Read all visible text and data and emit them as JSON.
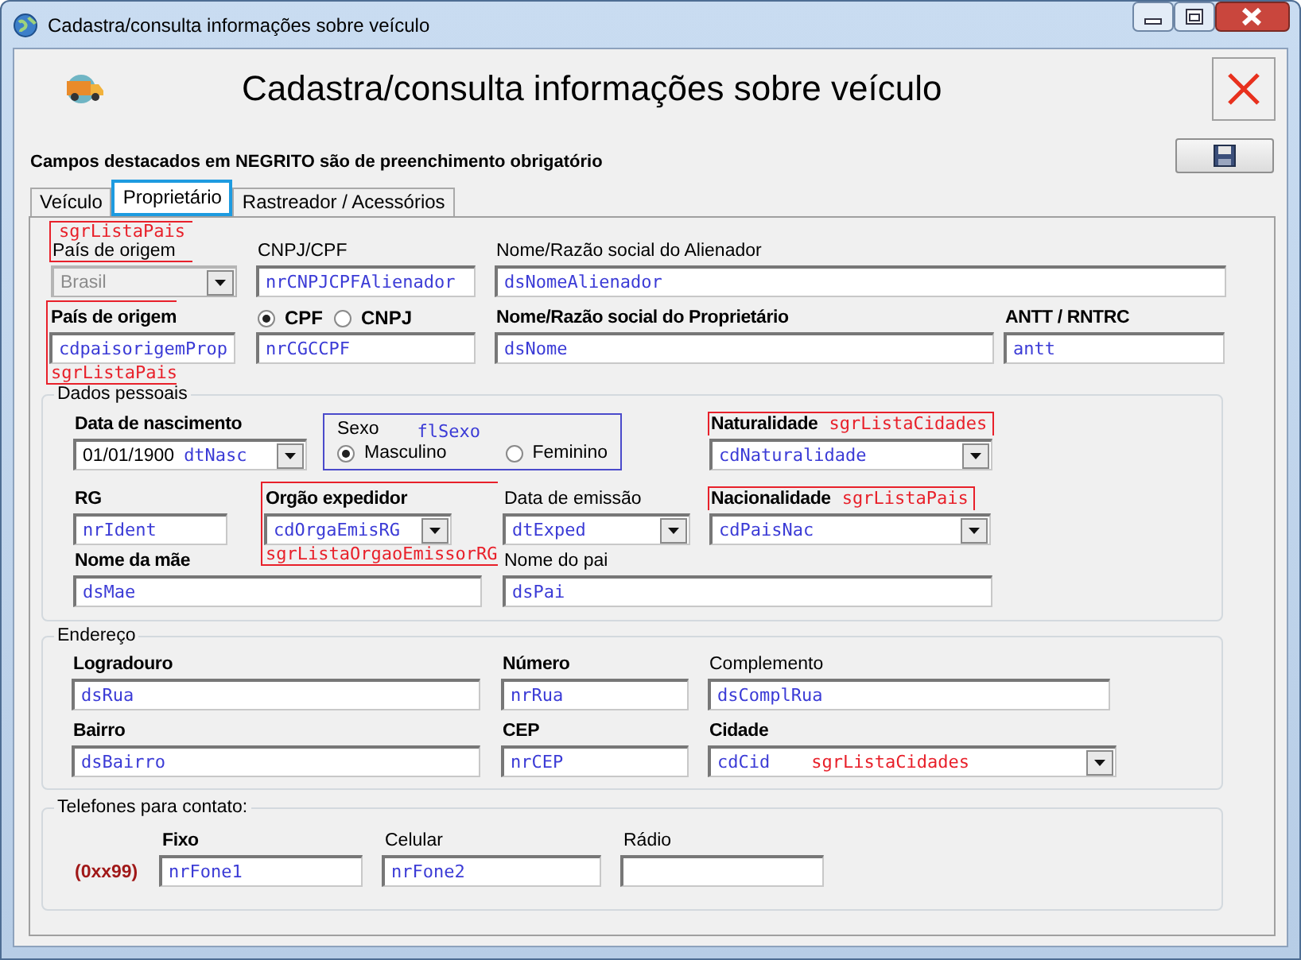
{
  "window": {
    "title": "Cadastra/consulta informações sobre veículo"
  },
  "header": {
    "title": "Cadastra/consulta informações sobre veículo"
  },
  "note": "Campos destacados em NEGRITO são de preenchimento obrigatório",
  "tabs": [
    {
      "label": "Veículo",
      "selected": false
    },
    {
      "label": "Proprietário",
      "selected": true
    },
    {
      "label": "Rastreador / Acessórios",
      "selected": false
    }
  ],
  "lines": [
    [
      {
        "kind": "combo",
        "label": "País de origem",
        "required": false,
        "value": "Brasil",
        "disabled": true,
        "annotation": {
          "text": "sgrListaPais",
          "kind": "above"
        }
      },
      {
        "kind": "text",
        "label": "CNPJ/CPF",
        "required": false,
        "binding": "nrCNPJCPFAlienador",
        "disabled": false
      },
      {
        "kind": "text",
        "label": "Nome/Razão social do Alienador",
        "required": false,
        "binding": "dsNomeAlienador",
        "disabled": false
      }
    ],
    [
      {
        "kind": "text",
        "label": "País de origem",
        "required": true,
        "binding": "cdpaisorigemProp",
        "disabled": false,
        "annotation": {
          "text": "sgrListaPais",
          "kind": "below"
        }
      },
      {
        "kind": "choice-text",
        "options": [
          {
            "label": "CPF",
            "selected": true
          },
          {
            "label": "CNPJ",
            "selected": false
          }
        ],
        "required": true,
        "binding": "nrCGCCPF",
        "disabled": false
      },
      {
        "kind": "text",
        "label": "Nome/Razão social do Proprietário",
        "required": true,
        "binding": "dsNome",
        "disabled": false
      },
      {
        "kind": "text",
        "label": "ANTT / RNTRC",
        "required": true,
        "binding": "antt",
        "disabled": false
      }
    ]
  ],
  "groups": [
    {
      "title": "Dados pessoais",
      "lines": [
        [
          {
            "kind": "combo",
            "label": "Data de nascimento",
            "required": true,
            "value": "01/01/1900",
            "binding": "dtNasc",
            "disabled": false
          },
          {
            "kind": "radio-group",
            "label": "Sexo",
            "binding": "flSexo",
            "options": [
              {
                "label": "Masculino",
                "selected": true
              },
              {
                "label": "Feminino",
                "selected": false
              }
            ]
          },
          {
            "kind": "combo",
            "label": "Naturalidade",
            "required": true,
            "binding": "cdNaturalidade",
            "disabled": false,
            "annotation": {
              "text": "sgrListaCidades",
              "kind": "beside"
            }
          }
        ],
        [
          {
            "kind": "text",
            "label": "RG",
            "required": true,
            "binding": "nrIdent",
            "disabled": false
          },
          {
            "kind": "combo",
            "label": "Orgão expedidor",
            "required": true,
            "binding": "cdOrgaEmisRG",
            "disabled": false,
            "annotation": {
              "text": "sgrListaOrgaoEmissorRG",
              "kind": "below"
            }
          },
          {
            "kind": "combo",
            "label": "Data de emissão",
            "required": false,
            "binding": "dtExped",
            "disabled": false
          },
          {
            "kind": "combo",
            "label": "Nacionalidade",
            "required": true,
            "binding": "cdPaisNac",
            "disabled": false,
            "annotation": {
              "text": "sgrListaPais",
              "kind": "beside"
            }
          }
        ],
        [
          {
            "kind": "text",
            "label": "Nome da mãe",
            "required": true,
            "binding": "dsMae",
            "disabled": false
          },
          {
            "kind": "text",
            "label": "Nome do pai",
            "required": false,
            "binding": "dsPai",
            "disabled": false
          }
        ]
      ]
    },
    {
      "title": "Endereço",
      "lines": [
        [
          {
            "kind": "text",
            "label": "Logradouro",
            "required": true,
            "binding": "dsRua",
            "disabled": false
          },
          {
            "kind": "text",
            "label": "Número",
            "required": true,
            "binding": "nrRua",
            "disabled": false
          },
          {
            "kind": "text",
            "label": "Complemento",
            "required": false,
            "binding": "dsComplRua",
            "disabled": false
          }
        ],
        [
          {
            "kind": "text",
            "label": "Bairro",
            "required": true,
            "binding": "dsBairro",
            "disabled": false
          },
          {
            "kind": "text",
            "label": "CEP",
            "required": true,
            "binding": "nrCEP",
            "disabled": false
          },
          {
            "kind": "combo",
            "label": "Cidade",
            "required": true,
            "binding": "cdCid",
            "disabled": false,
            "annotation": {
              "text": "sgrListaCidades",
              "kind": "inside"
            }
          }
        ]
      ]
    },
    {
      "title": "Telefones para contato:",
      "lines": [
        [
          {
            "kind": "prefix",
            "text": "(0xx99)"
          },
          {
            "kind": "text",
            "label": "Fixo",
            "required": true,
            "binding": "nrFone1",
            "disabled": false
          },
          {
            "kind": "text",
            "label": "Celular",
            "required": false,
            "binding": "nrFone2",
            "disabled": false
          },
          {
            "kind": "text",
            "label": "Rádio",
            "required": false,
            "disabled": false
          }
        ]
      ]
    }
  ]
}
